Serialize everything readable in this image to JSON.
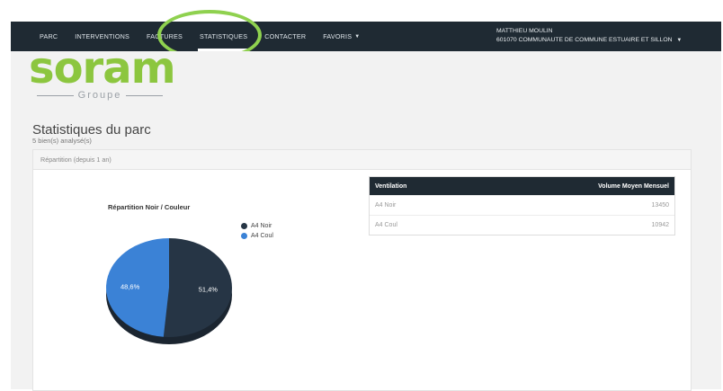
{
  "nav": {
    "items": [
      {
        "label": "PARC",
        "active": false
      },
      {
        "label": "INTERVENTIONS",
        "active": false
      },
      {
        "label": "FACTURES",
        "active": false
      },
      {
        "label": "STATISTIQUES",
        "active": true
      },
      {
        "label": "CONTACTER",
        "active": false
      },
      {
        "label": "FAVORIS",
        "active": false,
        "dropdown": true
      }
    ],
    "user_name": "MATTHIEU MOULIN",
    "user_org": "601070 COMMUNAUTE DE COMMUNE ESTUAIRE ET SILLON",
    "highlight_color": "#8fd14f"
  },
  "logo": {
    "main": "soram",
    "sub": "Groupe",
    "color": "#8cc63f"
  },
  "page": {
    "title": "Statistiques du parc",
    "subtitle": "5 bien(s) analysé(s)"
  },
  "panel": {
    "header": "Répartition (depuis 1 an)"
  },
  "chart_data": {
    "type": "pie",
    "title": "Répartition Noir / Couleur",
    "categories": [
      "A4 Noir",
      "A4 Coul"
    ],
    "values": [
      51.4,
      48.6
    ],
    "labels": [
      "51,4%",
      "48,6%"
    ],
    "colors": [
      "#263545",
      "#3b82d6"
    ],
    "legend_position": "right"
  },
  "table": {
    "headers": [
      "Ventilation",
      "Volume Moyen Mensuel"
    ],
    "rows": [
      [
        "A4 Noir",
        "13450"
      ],
      [
        "A4 Coul",
        "10942"
      ]
    ]
  }
}
